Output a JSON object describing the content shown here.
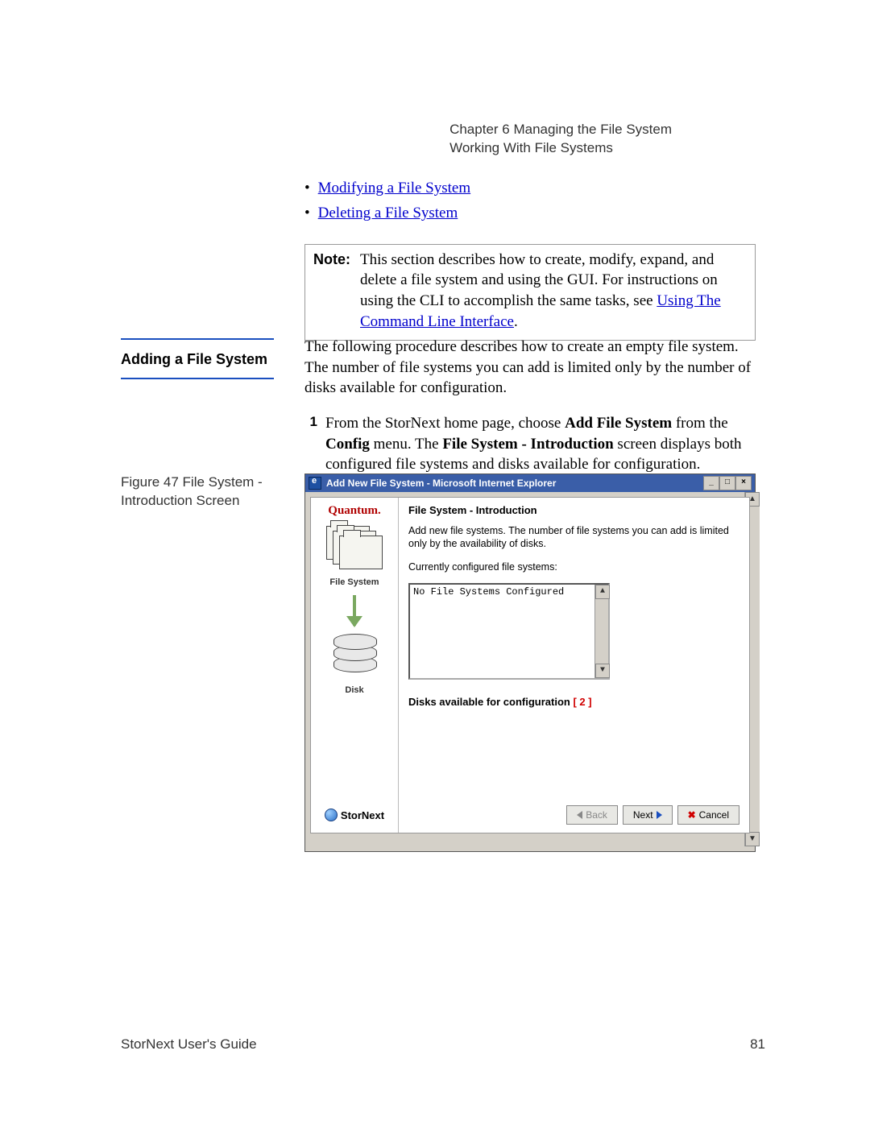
{
  "header": {
    "chapter": "Chapter 6  Managing the File System",
    "section": "Working With File Systems"
  },
  "bullets": {
    "b1": "Modifying a File System",
    "b2": "Deleting a File System"
  },
  "note": {
    "label": "Note:",
    "text_a": "This section describes how to create, modify, expand, and delete a file system and using the GUI. For instructions on using the CLI to accomplish the same tasks, see ",
    "link": "Using The Command Line Interface",
    "text_b": "."
  },
  "section": {
    "title": "Adding a File System",
    "intro": "The following procedure describes how to create an empty file system. The number of file systems you can add is limited only by the number of disks available for configuration.",
    "step_num": "1",
    "step_a": "From the StorNext home page, choose ",
    "step_b1": "Add File System",
    "step_c": " from the ",
    "step_b2": "Config",
    "step_d": " menu. The ",
    "step_b3": "File System - Introduction",
    "step_e": " screen displays both configured file systems and disks available for configuration."
  },
  "figure": {
    "caption_a": "Figure 47  File System -",
    "caption_b": "Introduction Screen"
  },
  "window": {
    "title": "Add New File System - Microsoft Internet Explorer",
    "brand": "Quantum.",
    "lp_fs": "File System",
    "lp_disk": "Disk",
    "lp_sn": "StorNext",
    "rp_title": "File System - Introduction",
    "rp_text": "Add new file systems. The number of file systems you can add is limited only by the availability of disks.",
    "rp_curr": "Currently configured file systems:",
    "list_item": "No File Systems Configured",
    "disks_avail": "Disks available for configuration ",
    "disks_count": "[ 2 ]",
    "btn_back": "Back",
    "btn_next": "Next",
    "btn_cancel": "Cancel"
  },
  "footer": {
    "left": "StorNext User's Guide",
    "right": "81"
  }
}
